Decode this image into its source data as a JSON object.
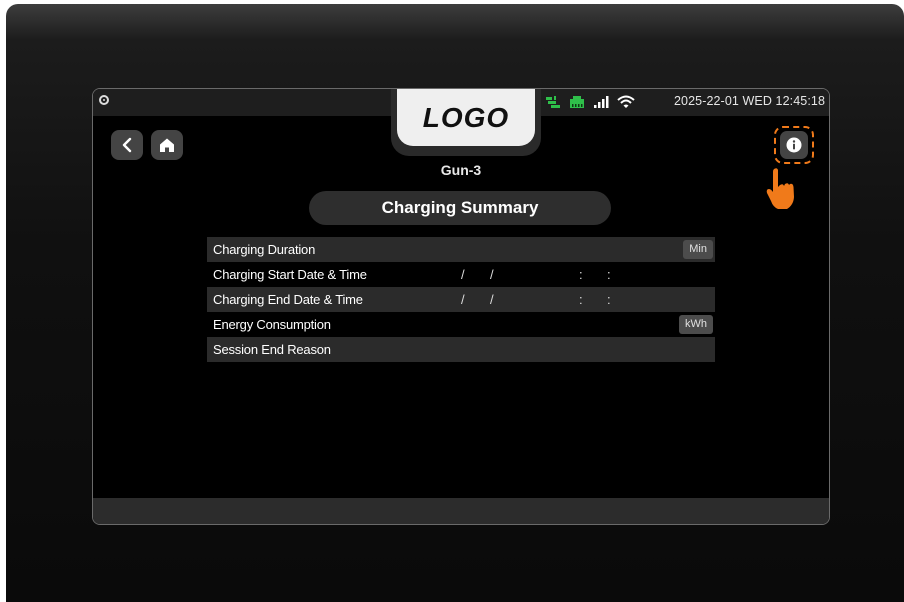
{
  "status_bar": {
    "datetime": "2025-22-01 WED 12:45:18",
    "icons": [
      "camera-icon",
      "charger-connected-icon",
      "ethernet-icon",
      "signal-bars-icon",
      "wifi-icon"
    ],
    "accent_green": "#2fbf4a"
  },
  "header": {
    "logo": "LOGO",
    "gun": "Gun-3",
    "title": "Charging Summary"
  },
  "nav": {
    "back_icon": "chevron-left-icon",
    "home_icon": "home-icon",
    "info_icon": "info-icon",
    "highlight_color": "#f07a1a"
  },
  "summary": {
    "rows": [
      {
        "label": "Charging Duration",
        "unit": "Min"
      },
      {
        "label": "Charging Start Date & Time",
        "date_sep": "/",
        "time_sep": ":"
      },
      {
        "label": "Charging End Date & Time",
        "date_sep": "/",
        "time_sep": ":"
      },
      {
        "label": "Energy Consumption",
        "unit": "kWh"
      },
      {
        "label": "Session End Reason"
      }
    ]
  }
}
